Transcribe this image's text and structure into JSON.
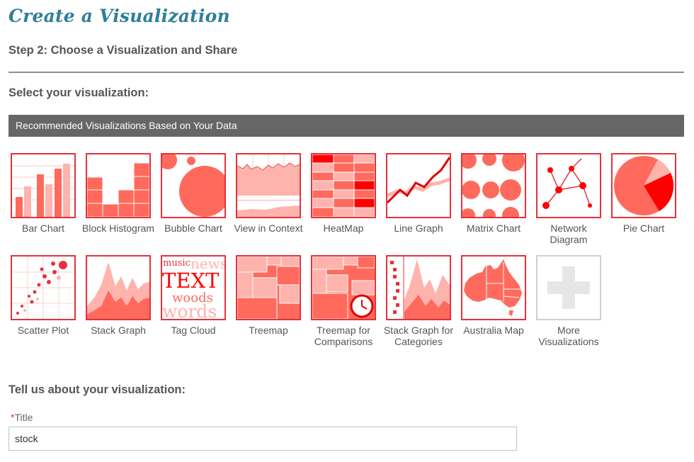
{
  "header": {
    "title": "Create a Visualization",
    "step": "Step 2: Choose a Visualization and Share"
  },
  "select_section": {
    "heading": "Select your visualization:",
    "recommended_bar": "Recommended Visualizations Based on Your Data"
  },
  "visualizations": [
    {
      "label": "Bar Chart",
      "icon": "bar-chart-icon"
    },
    {
      "label": "Block Histogram",
      "icon": "block-histogram-icon"
    },
    {
      "label": "Bubble Chart",
      "icon": "bubble-chart-icon"
    },
    {
      "label": "View in Context",
      "icon": "view-in-context-icon"
    },
    {
      "label": "HeatMap",
      "icon": "heatmap-icon"
    },
    {
      "label": "Line Graph",
      "icon": "line-graph-icon"
    },
    {
      "label": "Matrix Chart",
      "icon": "matrix-chart-icon"
    },
    {
      "label": "Network Diagram",
      "icon": "network-diagram-icon"
    },
    {
      "label": "Pie Chart",
      "icon": "pie-chart-icon"
    },
    {
      "label": "Scatter Plot",
      "icon": "scatter-plot-icon"
    },
    {
      "label": "Stack Graph",
      "icon": "stack-graph-icon"
    },
    {
      "label": "Tag Cloud",
      "icon": "tag-cloud-icon"
    },
    {
      "label": "Treemap",
      "icon": "treemap-icon"
    },
    {
      "label": "Treemap for Comparisons",
      "icon": "treemap-comparisons-icon"
    },
    {
      "label": "Stack Graph for Categories",
      "icon": "stack-graph-categories-icon"
    },
    {
      "label": "Australia Map",
      "icon": "australia-map-icon"
    },
    {
      "label": "More Visualizations",
      "icon": "plus-icon"
    }
  ],
  "tag_cloud_words": [
    "music",
    "news",
    "TEXT",
    "woods",
    "words"
  ],
  "about_section": {
    "heading": "Tell us about your visualization:",
    "required_mark": "*",
    "title_label": "Title",
    "title_value": "stock"
  },
  "colors": {
    "accent_title": "#2e7f99",
    "thumb_border": "#e5323b",
    "red": "#ff0000",
    "salmon": "#ff6a5c",
    "pink": "#ffb3ad",
    "bar_gray": "#666666"
  }
}
